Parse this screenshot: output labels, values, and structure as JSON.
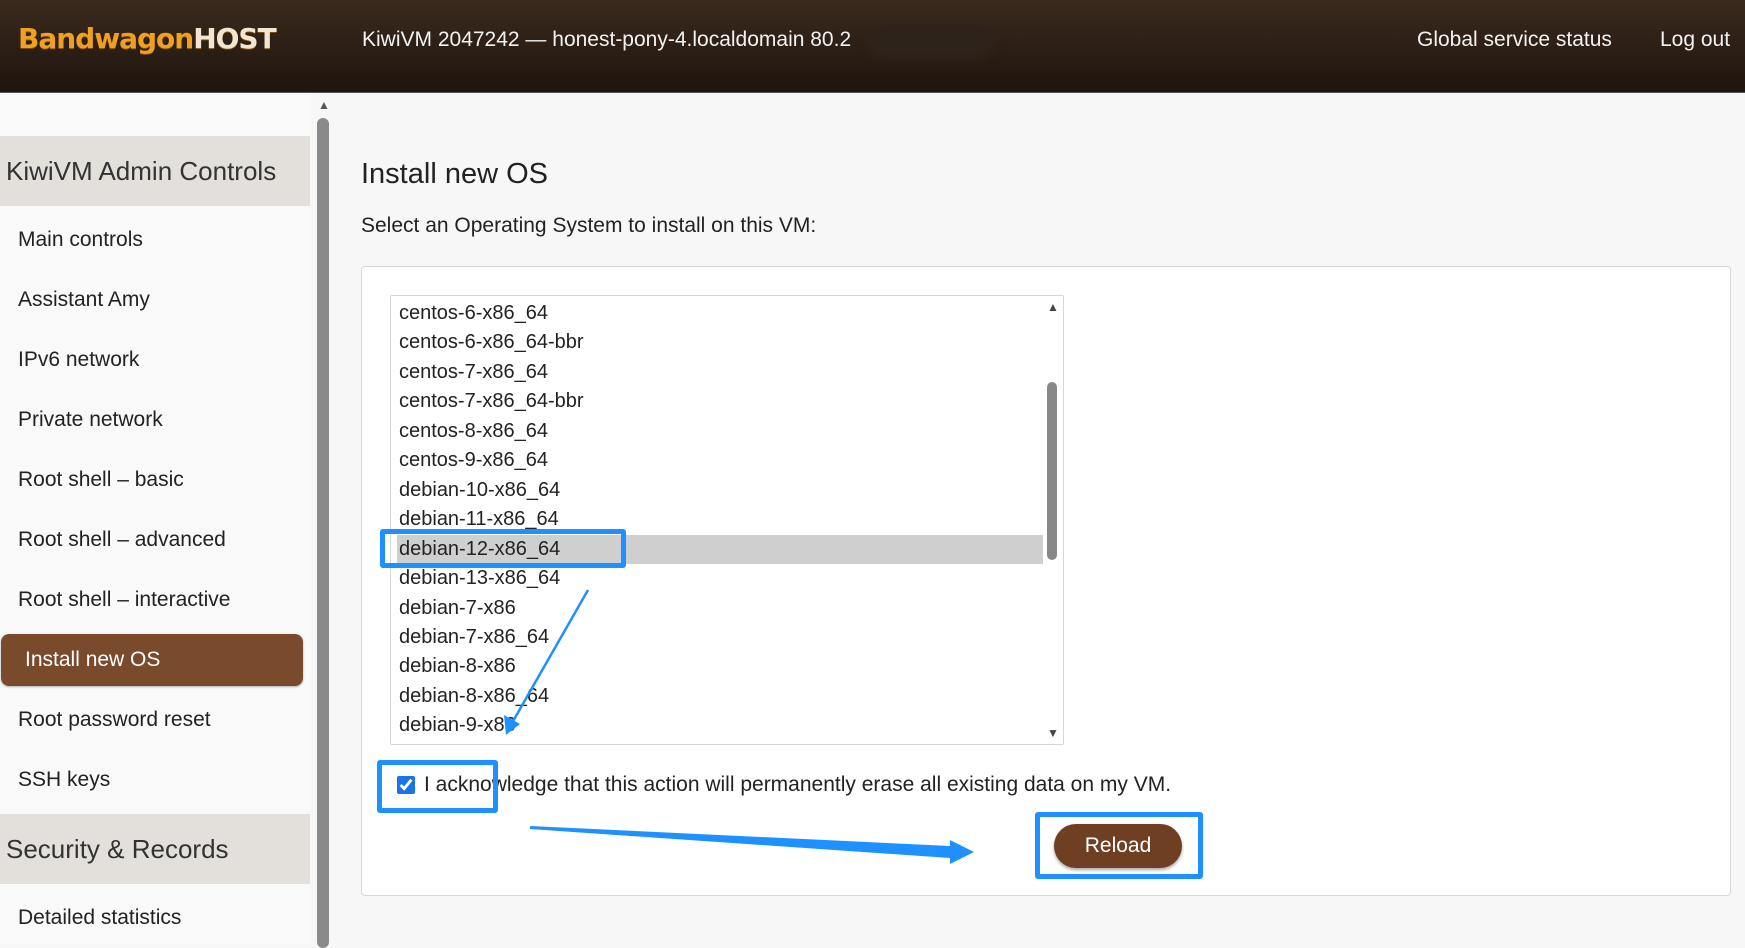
{
  "header": {
    "logo_brand": "Bandwagon",
    "logo_host": "HOST",
    "vm_title": "KiwiVM 2047242 — honest-pony-4.localdomain   80.2",
    "global_status_label": "Global service status",
    "logout_label": "Log out"
  },
  "sidebar": {
    "admin_heading": "KiwiVM Admin Controls",
    "items": [
      {
        "label": "Main controls"
      },
      {
        "label": "Assistant Amy"
      },
      {
        "label": "IPv6 network"
      },
      {
        "label": "Private network"
      },
      {
        "label": "Root shell – basic"
      },
      {
        "label": "Root shell – advanced"
      },
      {
        "label": "Root shell – interactive"
      },
      {
        "label": "Install new OS",
        "active": true
      },
      {
        "label": "Root password reset"
      },
      {
        "label": "SSH keys"
      }
    ],
    "security_heading": "Security & Records",
    "security_items": [
      {
        "label": "Detailed statistics"
      }
    ]
  },
  "main": {
    "title": "Install new OS",
    "subtitle": "Select an Operating System to install on this VM:",
    "os_options": [
      "centos-6-x86_64",
      "centos-6-x86_64-bbr",
      "centos-7-x86_64",
      "centos-7-x86_64-bbr",
      "centos-8-x86_64",
      "centos-9-x86_64",
      "debian-10-x86_64",
      "debian-11-x86_64",
      "debian-12-x86_64",
      "debian-13-x86_64",
      "debian-7-x86",
      "debian-7-x86_64",
      "debian-8-x86",
      "debian-8-x86_64",
      "debian-9-x86"
    ],
    "selected_os": "debian-12-x86_64",
    "acknowledge_label": "I acknowledge that this action will permanently erase all existing data on my VM.",
    "acknowledge_checked": true,
    "reload_label": "Reload"
  },
  "colors": {
    "header_bg": "#2a1d14",
    "brand_orange": "#f0a020",
    "active_nav": "#7a4a2c",
    "button_brown": "#6e3f22",
    "annotation_blue": "#1e90ff",
    "selected_row": "#cfcfcf"
  },
  "icons": [
    "scroll-up-arrow-icon",
    "scroll-down-arrow-icon",
    "checkbox-checked-icon",
    "annotation-arrow-icon"
  ]
}
